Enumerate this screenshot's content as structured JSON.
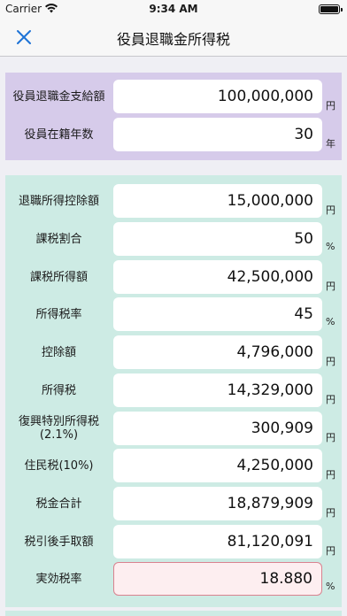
{
  "status": {
    "carrier": "Carrier",
    "time": "9:34 AM"
  },
  "nav": {
    "title": "役員退職金所得税",
    "close_icon": "close-icon"
  },
  "inputs": [
    {
      "label": "役員退職金支給額",
      "value": "100,000,000",
      "unit": "円"
    },
    {
      "label": "役員在籍年数",
      "value": "30",
      "unit": "年"
    }
  ],
  "results": [
    {
      "label": "退職所得控除額",
      "value": "15,000,000",
      "unit": "円"
    },
    {
      "label": "課税割合",
      "value": "50",
      "unit": "%"
    },
    {
      "label": "課税所得額",
      "value": "42,500,000",
      "unit": "円"
    },
    {
      "label": "所得税率",
      "value": "45",
      "unit": "%"
    },
    {
      "label": "控除額",
      "value": "4,796,000",
      "unit": "円"
    },
    {
      "label": "所得税",
      "value": "14,329,000",
      "unit": "円"
    },
    {
      "label": "復興特別所得税\n(2.1%)",
      "value": "300,909",
      "unit": "円"
    },
    {
      "label": "住民税(10%)",
      "value": "4,250,000",
      "unit": "円"
    },
    {
      "label": "税金合計",
      "value": "18,879,909",
      "unit": "円"
    },
    {
      "label": "税引後手取額",
      "value": "81,120,091",
      "unit": "円"
    },
    {
      "label": "実効税率",
      "value": "18.880",
      "unit": "%"
    }
  ],
  "colors": {
    "input_panel": "#d6cbea",
    "results_panel": "#cdebe4",
    "highlight_border": "#d9828f",
    "accent": "#1e73d6"
  }
}
